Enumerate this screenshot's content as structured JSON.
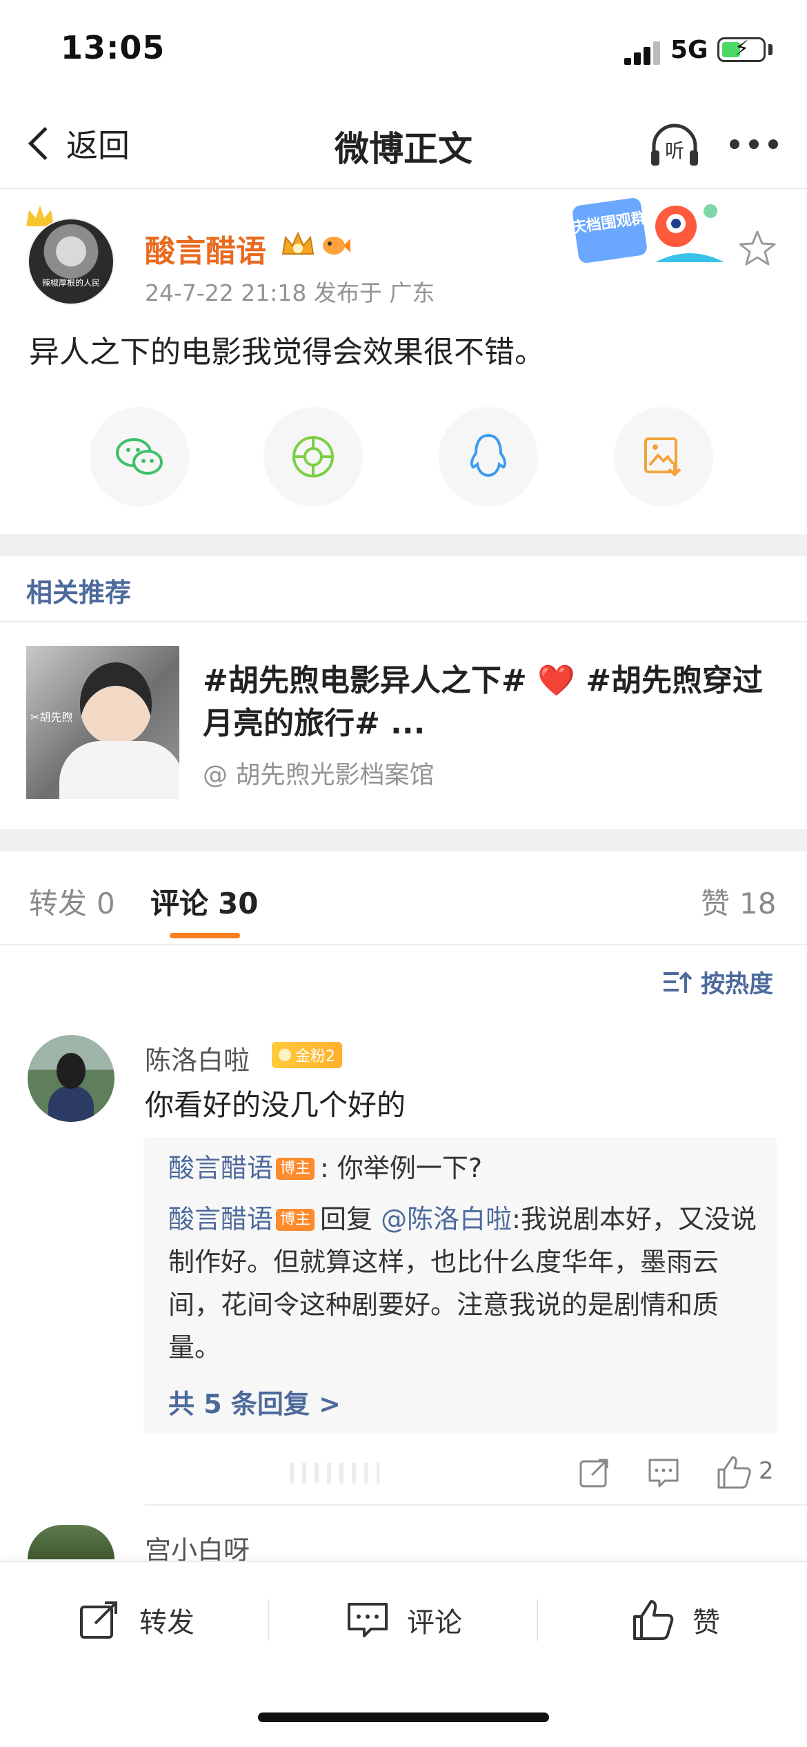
{
  "status_bar": {
    "time": "13:05",
    "network": "5G"
  },
  "nav": {
    "back_label": "返回",
    "title": "微博正文",
    "listen_label": "听"
  },
  "post": {
    "author": "酸言醋语",
    "avatar_caption": "辣椒厚根的人民",
    "meta": "24-7-22 21:18  发布于 广东",
    "promo_text": "国庆档围观群众",
    "text": "异人之下的电影我觉得会效果很不错。",
    "share_icons": [
      "wechat-icon",
      "moments-icon",
      "qq-icon",
      "save-image-icon"
    ]
  },
  "related": {
    "label": "相关推荐",
    "title_part1": "#胡先煦电影异人之下#",
    "heart": "❤️",
    "title_part2": "#胡先煦穿过月亮的旅行# ...",
    "source": "@ 胡先煦光影档案馆",
    "thumb_tag": "✂胡先煦"
  },
  "tabs": {
    "repost_label": "转发",
    "repost_count": "0",
    "comment_label": "评论",
    "comment_count": "30",
    "like_label": "赞",
    "like_count": "18"
  },
  "sort": {
    "label": "按热度"
  },
  "comments": [
    {
      "name": "陈洛白啦",
      "badge": "金粉2",
      "text": "你看好的没几个好的",
      "replies": {
        "r1_name": "酸言醋语",
        "owner_tag": "博主",
        "r1_text": ": 你举例一下?",
        "r2_name": "酸言醋语",
        "r2_reply_word": "回复",
        "r2_mention": "@陈洛白啦",
        "r2_text": ":我说剧本好，又没说制作好。但就算这样，也比什么度华年，墨雨云间，花间令这种剧要好。注意我说的是剧情和质量。",
        "more": "共 5 条回复 >"
      },
      "like_count": "2"
    },
    {
      "name": "宫小白呀"
    }
  ],
  "bottom_bar": {
    "repost": "转发",
    "comment": "评论",
    "like": "赞"
  },
  "colors": {
    "accent_orange": "#ff7f1e",
    "author_orange": "#e86b1f",
    "link_blue": "#4d6a9c"
  }
}
